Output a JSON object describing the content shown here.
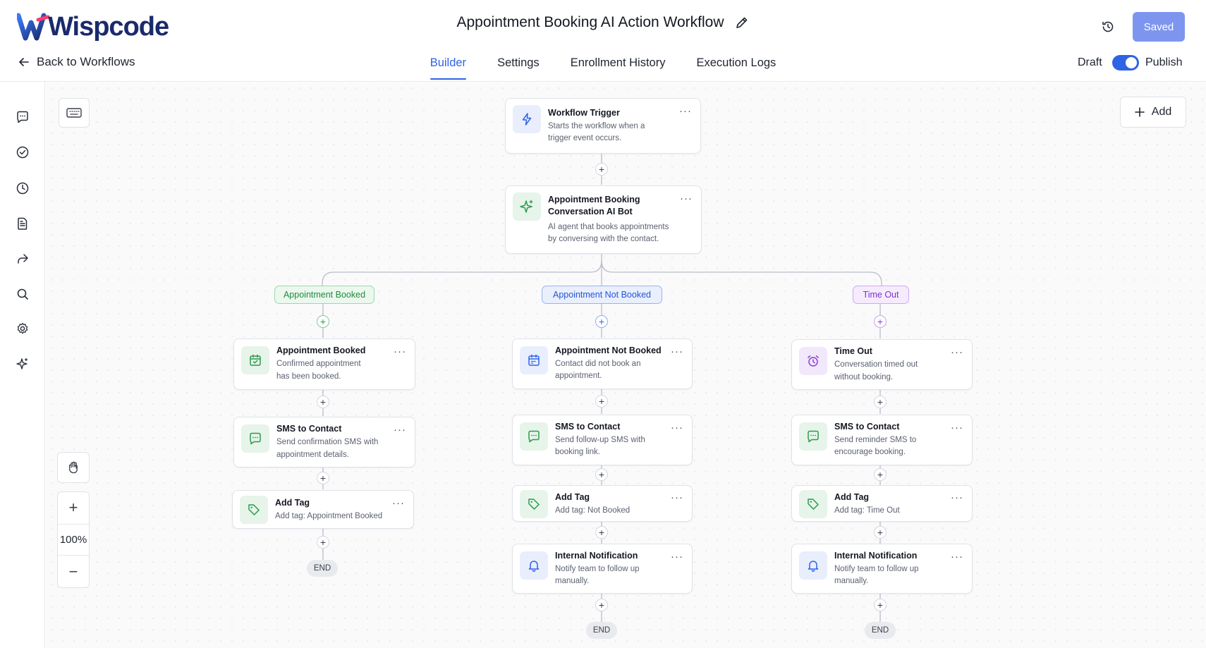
{
  "app": {
    "brand": "Wispcode",
    "back_label": "Back to Workflows",
    "title": "Appointment Booking AI Action Workflow",
    "tabs": [
      "Builder",
      "Settings",
      "Enrollment History",
      "Execution Logs"
    ],
    "active_tab": "Builder",
    "saved_label": "Saved",
    "draft_label": "Draft",
    "publish_label": "Publish",
    "publish_toggle_on": true
  },
  "colors": {
    "accent": "#2f63e6",
    "saved_button": "#7e95f0",
    "green": "#21893e",
    "purple": "#7d33cc"
  },
  "sidebar": {
    "icons": [
      "chat-icon",
      "check-circle-icon",
      "clock-icon",
      "document-icon",
      "share-icon",
      "search-icon",
      "gear-icon",
      "sparkle-icon"
    ]
  },
  "canvas": {
    "add_label": "Add",
    "zoom_level": "100%",
    "zoom_in": "+",
    "zoom_out": "−"
  },
  "trigger": {
    "title": "Workflow Trigger",
    "desc_1": "Starts the workflow when a",
    "desc_2": "trigger event occurs."
  },
  "ai_bot": {
    "title_1": "Appointment Booking",
    "title_2": "Conversation AI Bot",
    "desc_1": "AI agent that books appointments",
    "desc_2": "by conversing with the contact."
  },
  "branches": [
    {
      "label": "Appointment Booked",
      "nodes": [
        {
          "title": "Appointment Booked",
          "desc_1": "Confirmed appointment",
          "desc_2": "has been booked."
        },
        {
          "title": "SMS to Contact",
          "desc_1": "Send confirmation SMS with",
          "desc_2": "appointment details."
        },
        {
          "title": "Add Tag",
          "desc_1": "Add tag: Appointment Booked",
          "desc_2": ""
        }
      ],
      "end": "END"
    },
    {
      "label": "Appointment Not Booked",
      "nodes": [
        {
          "title": "Appointment Not Booked",
          "desc_1": "Contact did not book an",
          "desc_2": "appointment."
        },
        {
          "title": "SMS to Contact",
          "desc_1": "Send follow-up SMS with",
          "desc_2": "booking link."
        },
        {
          "title": "Add Tag",
          "desc_1": "Add tag: Not Booked",
          "desc_2": ""
        },
        {
          "title": "Internal Notification",
          "desc_1": "Notify team to follow up",
          "desc_2": "manually."
        }
      ],
      "end": "END"
    },
    {
      "label": "Time Out",
      "nodes": [
        {
          "title": "Time Out",
          "desc_1": "Conversation timed out",
          "desc_2": "without booking."
        },
        {
          "title": "SMS to Contact",
          "desc_1": "Send reminder SMS to",
          "desc_2": "encourage booking."
        },
        {
          "title": "Add Tag",
          "desc_1": "Add tag: Time Out",
          "desc_2": ""
        },
        {
          "title": "Internal Notification",
          "desc_1": "Notify team to follow up",
          "desc_2": "manually."
        }
      ],
      "end": "END"
    }
  ]
}
